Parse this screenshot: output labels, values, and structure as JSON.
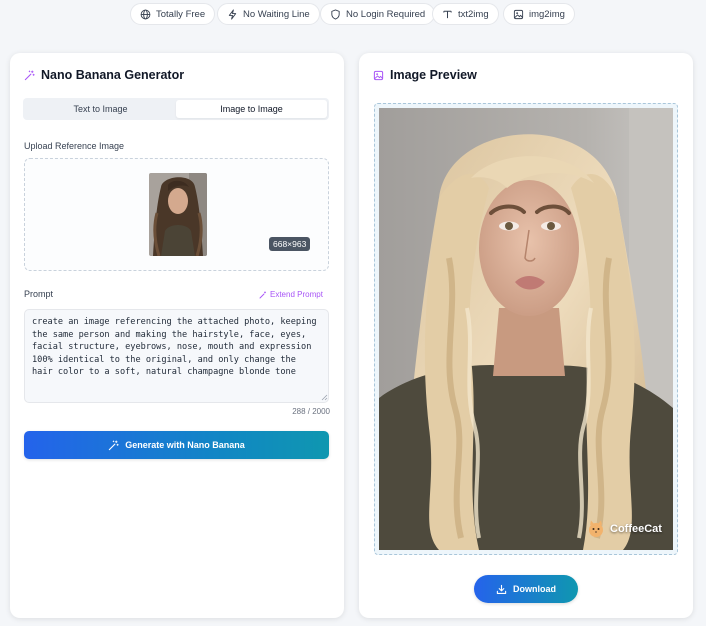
{
  "pills": [
    {
      "label": "Totally Free",
      "icon": "globe-icon"
    },
    {
      "label": "No Waiting Line",
      "icon": "lightning-icon"
    },
    {
      "label": "No Login Required",
      "icon": "shield-icon"
    },
    {
      "label": "txt2img",
      "icon": "text-icon"
    },
    {
      "label": "img2img",
      "icon": "image-icon"
    }
  ],
  "generator": {
    "title": "Nano Banana Generator",
    "tabs": [
      {
        "label": "Text to Image",
        "active": false
      },
      {
        "label": "Image to Image",
        "active": true
      }
    ],
    "upload_label": "Upload Reference Image",
    "image_dimensions": "668×963",
    "prompt_label": "Prompt",
    "extend_prompt": "Extend Prompt",
    "prompt_text": "create an image referencing the attached photo, keeping the same person and making the hairstyle, face, eyes, facial structure, eyebrows, nose, mouth and expression 100% identical to the original, and only change the hair color to a soft, natural champagne blonde tone",
    "char_count": "288 / 2000",
    "generate_button": "Generate with Nano Banana"
  },
  "preview": {
    "title": "Image Preview",
    "watermark": "CoffeeCat",
    "download_button": "Download"
  },
  "colors": {
    "accent_blue": "#2463eb",
    "accent_teal": "#0f97b0",
    "accent_purple": "#a855f7"
  }
}
